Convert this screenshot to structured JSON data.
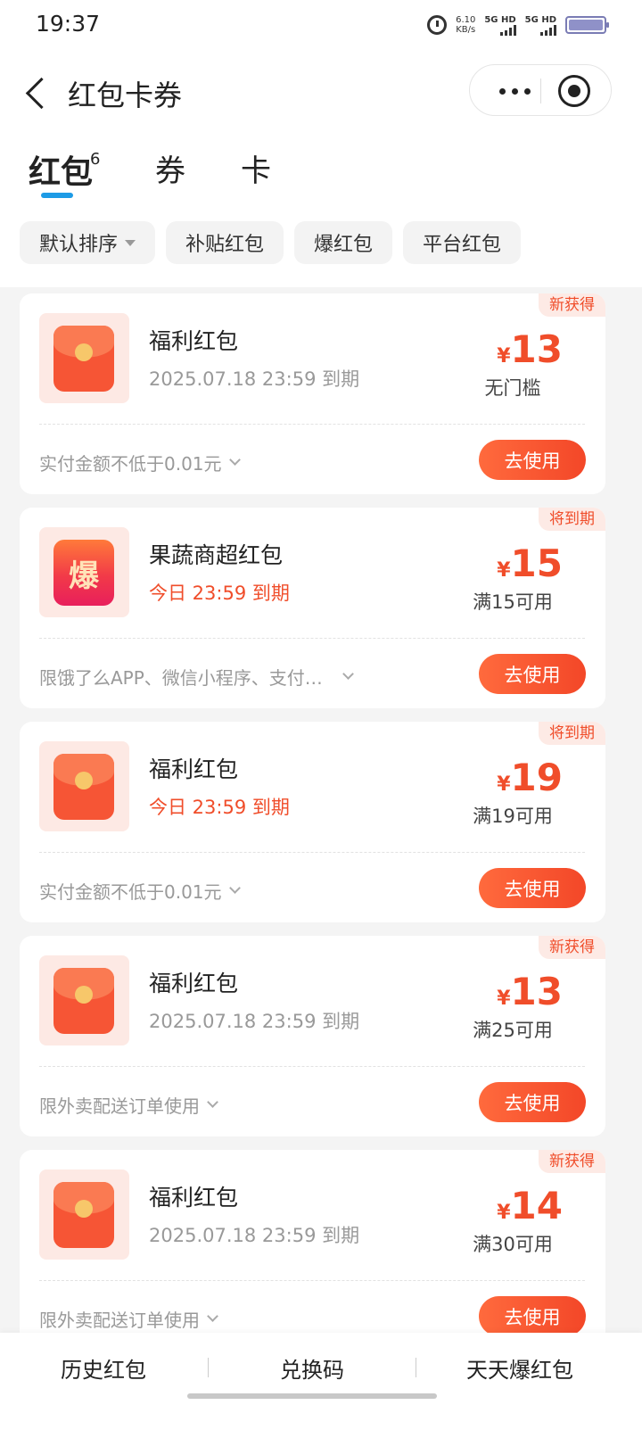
{
  "status_bar": {
    "time": "19:37",
    "net_speed": "6.10",
    "net_unit": "KB/s",
    "sig1": "5G HD",
    "sig2": "5G HD"
  },
  "nav": {
    "title": "红包卡券"
  },
  "tabs": [
    {
      "label": "红包",
      "count": "6"
    },
    {
      "label": "券"
    },
    {
      "label": "卡"
    }
  ],
  "filters": [
    "默认排序",
    "补贴红包",
    "爆红包",
    "平台红包"
  ],
  "cards": [
    {
      "tag": "新获得",
      "icon": "red-envelope-icon",
      "name": "福利红包",
      "expiry": "2025.07.18 23:59 到期",
      "urgent": false,
      "currency": "¥",
      "amount": "13",
      "threshold": "无门槛",
      "rule": "实付金额不低于0.01元",
      "button": "去使用"
    },
    {
      "tag": "将到期",
      "icon": "bao-icon",
      "icon_text": "爆",
      "name": "果蔬商超红包",
      "expiry": "今日 23:59 到期",
      "urgent": true,
      "currency": "¥",
      "amount": "15",
      "threshold": "满15可用",
      "rule": "限饿了么APP、微信小程序、支付…",
      "button": "去使用"
    },
    {
      "tag": "将到期",
      "icon": "red-envelope-icon",
      "name": "福利红包",
      "expiry": "今日 23:59 到期",
      "urgent": true,
      "currency": "¥",
      "amount": "19",
      "threshold": "满19可用",
      "rule": "实付金额不低于0.01元",
      "button": "去使用"
    },
    {
      "tag": "新获得",
      "icon": "red-envelope-icon",
      "name": "福利红包",
      "expiry": "2025.07.18 23:59 到期",
      "urgent": false,
      "currency": "¥",
      "amount": "13",
      "threshold": "满25可用",
      "rule": "限外卖配送订单使用",
      "button": "去使用"
    },
    {
      "tag": "新获得",
      "icon": "red-envelope-icon",
      "name": "福利红包",
      "expiry": "2025.07.18 23:59 到期",
      "urgent": false,
      "currency": "¥",
      "amount": "14",
      "threshold": "满30可用",
      "rule": "限外卖配送订单使用",
      "button": "去使用"
    }
  ],
  "bottom": [
    "历史红包",
    "兑换码",
    "天天爆红包"
  ],
  "colors": {
    "accent": "#f04d2a",
    "tab_indicator": "#1d9be6",
    "tag_bg": "#fdeae5"
  }
}
